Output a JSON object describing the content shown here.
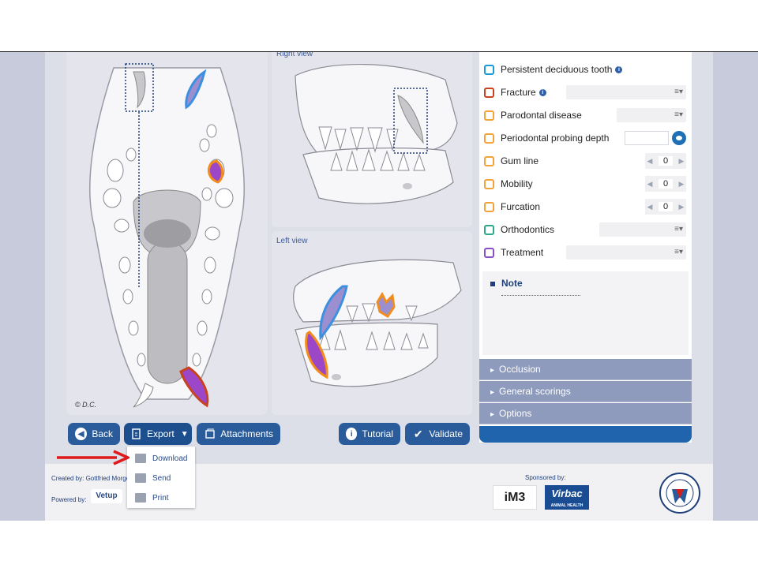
{
  "views": {
    "right_label": "Right view",
    "left_label": "Left view",
    "copyright": "© D.C."
  },
  "options": [
    {
      "label": "Persistent deciduous tooth",
      "color": "#1a9ad6",
      "info": true,
      "control": "none"
    },
    {
      "label": "Fracture",
      "color": "#c8421e",
      "info": true,
      "control": "select"
    },
    {
      "label": "Parodontal disease",
      "color": "#f2a43a",
      "info": false,
      "control": "select"
    },
    {
      "label": "Periodontal probing depth",
      "color": "#f2a43a",
      "info": false,
      "control": "depth"
    },
    {
      "label": "Gum line",
      "color": "#f2a43a",
      "info": false,
      "control": "stepper",
      "value": "0"
    },
    {
      "label": "Mobility",
      "color": "#f2a43a",
      "info": false,
      "control": "stepper",
      "value": "0"
    },
    {
      "label": "Furcation",
      "color": "#f2a43a",
      "info": false,
      "control": "stepper",
      "value": "0"
    },
    {
      "label": "Orthodontics",
      "color": "#2aa88a",
      "info": false,
      "control": "select"
    },
    {
      "label": "Treatment",
      "color": "#8a4fc2",
      "info": false,
      "control": "select"
    }
  ],
  "info_glyph": "i",
  "select_glyph": "≡▾",
  "stepper_left": "◀",
  "stepper_right": "▶",
  "note": {
    "title": "Note"
  },
  "accordion": [
    "Occlusion",
    "General scorings",
    "Options"
  ],
  "buttons": {
    "back": "Back",
    "export": "Export",
    "attachments": "Attachments",
    "tutorial": "Tutorial",
    "validate": "Validate"
  },
  "export_menu": [
    "Download",
    "Send",
    "Print"
  ],
  "footer": {
    "created_by": "Created by: Gottfried Morgene",
    "powered_by": "Powered by:",
    "vetup": "Vetup",
    "sponsored_by": "Sponsored by:",
    "im3": "iM3",
    "virbac": "Virbac",
    "virbac_sub": "ANIMAL HEALTH"
  },
  "colors": {
    "accent": "#2a5c9b",
    "accordion": "#8f9bbd",
    "arrow": "#e0191b",
    "lesion_purple": "#9b47c8",
    "lesion_orange": "#f28c1a",
    "lesion_blue": "#3d8fe0"
  }
}
